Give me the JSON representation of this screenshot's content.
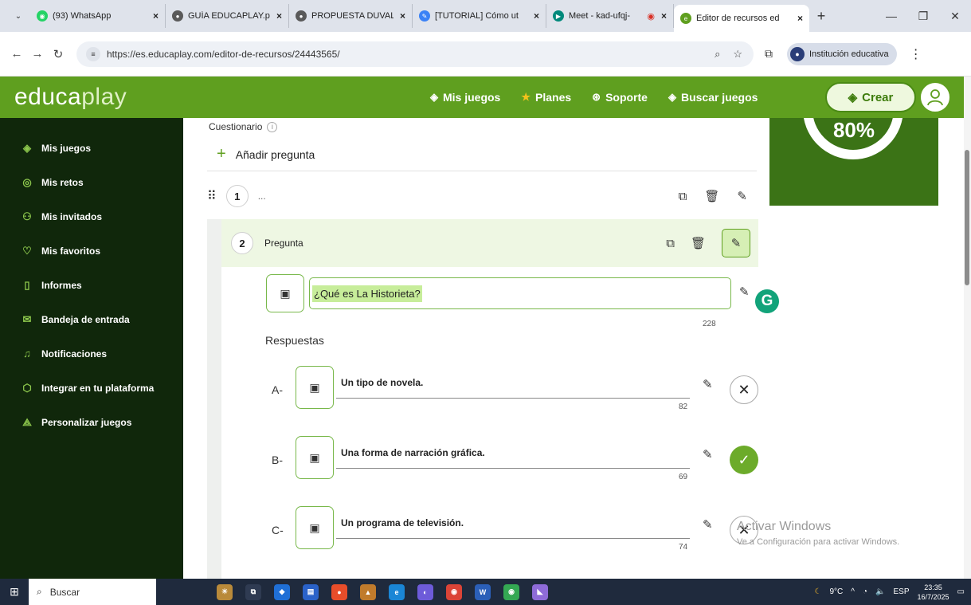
{
  "browser": {
    "tabs": [
      {
        "label": "(93) WhatsApp",
        "icon": "whatsapp-icon",
        "color": "#25d366"
      },
      {
        "label": "GUÍA EDUCAPLAY.pd",
        "icon": "globe-icon",
        "color": "#5a5a5a"
      },
      {
        "label": "PROPUESTA DUVAL Y",
        "icon": "globe-icon",
        "color": "#5a5a5a"
      },
      {
        "label": "[TUTORIAL] Cómo ut",
        "icon": "pencil-icon",
        "color": "#3b82f6"
      },
      {
        "label": "Meet - kad-ufqj-",
        "icon": "meet-icon",
        "color": "#00897b"
      },
      {
        "label": "Editor de recursos ed",
        "icon": "educaplay-icon",
        "color": "#5f9f1f"
      }
    ],
    "url": "https://es.educaplay.com/editor-de-recursos/24443565/",
    "profile_label": "Institución educativa"
  },
  "header": {
    "logo_main": "educa",
    "logo_accent": "play",
    "nav": [
      {
        "label": "Mis juegos",
        "icon": "gamepad-icon"
      },
      {
        "label": "Planes",
        "icon": "star-icon"
      },
      {
        "label": "Soporte",
        "icon": "support-icon"
      },
      {
        "label": "Buscar juegos",
        "icon": "search-games-icon"
      }
    ],
    "create_label": "Crear"
  },
  "sidebar": {
    "items": [
      {
        "label": "Mis juegos",
        "icon": "gamepad-icon"
      },
      {
        "label": "Mis retos",
        "icon": "target-icon"
      },
      {
        "label": "Mis invitados",
        "icon": "users-icon"
      },
      {
        "label": "Mis favoritos",
        "icon": "heart-icon"
      },
      {
        "label": "Informes",
        "icon": "report-icon"
      },
      {
        "label": "Bandeja de entrada",
        "icon": "mail-icon"
      },
      {
        "label": "Notificaciones",
        "icon": "bell-icon"
      },
      {
        "label": "Integrar en tu plataforma",
        "icon": "cube-icon"
      },
      {
        "label": "Personalizar juegos",
        "icon": "palette-icon"
      }
    ]
  },
  "editor": {
    "section_label": "Cuestionario",
    "add_question_label": "Añadir pregunta",
    "q1": {
      "number": "1",
      "text": "..."
    },
    "q2": {
      "number": "2",
      "label": "Pregunta",
      "question_text": "¿Qué es La Historieta?",
      "char_count": "228",
      "answers_title": "Respuestas",
      "answers": [
        {
          "letter": "A-",
          "text": "Un tipo de novela.",
          "count": "82",
          "correct": false
        },
        {
          "letter": "B-",
          "text": "Una forma de narración gráfica.",
          "count": "69",
          "correct": true
        },
        {
          "letter": "C-",
          "text": "Un programa de televisión.",
          "count": "74",
          "correct": false
        }
      ]
    }
  },
  "progress": {
    "value": "80%",
    "percent": 80
  },
  "watermark": {
    "line1": "Activar Windows",
    "line2": "Ve a Configuración para activar Windows."
  },
  "taskbar": {
    "search_label": "Buscar",
    "weather": "9°C",
    "language": "ESP",
    "time": "23:35",
    "date": "16/7/2025"
  },
  "colors": {
    "brand_green": "#5f9f1f",
    "sidebar_bg": "#10270b",
    "correct_green": "#6cab2a"
  }
}
